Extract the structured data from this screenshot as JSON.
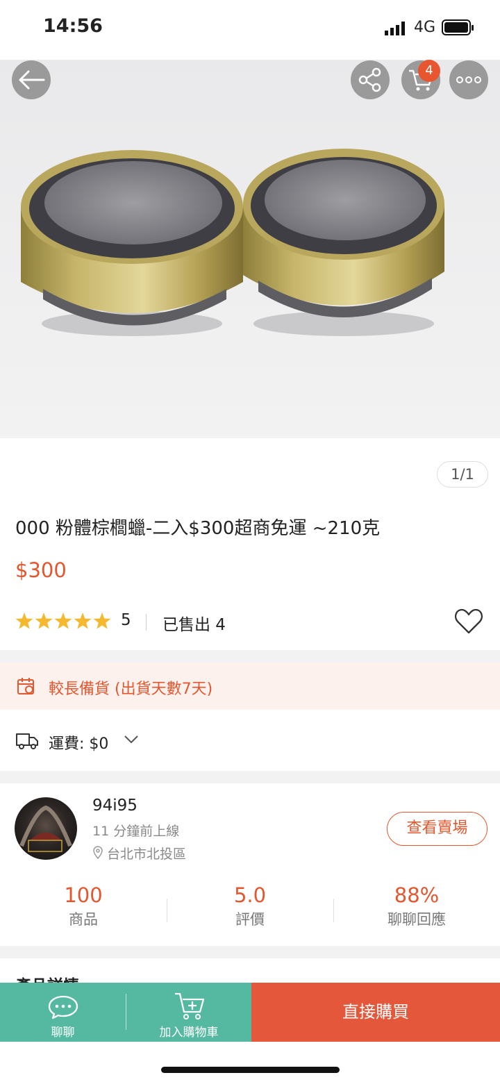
{
  "status_bar": {
    "time": "14:56",
    "network": "4G"
  },
  "product": {
    "image_counter": "1/1",
    "title": "000 粉體棕櫚蠟-二入$300超商免運 ~210克",
    "price": "$300",
    "rating_value": 5,
    "rating_count": "5",
    "sold": "已售出 4",
    "cart_count": "4"
  },
  "notices": {
    "preorder": "較長備貨 (出貨天數7天)",
    "shipping": "運費: $0"
  },
  "seller": {
    "name": "94i95",
    "online": "11 分鐘前上線",
    "location": "台北市北投區",
    "view_shop_label": "查看賣場",
    "stats": [
      {
        "value": "100",
        "label": "商品"
      },
      {
        "value": "5.0",
        "label": "評價"
      },
      {
        "value": "88%",
        "label": "聊聊回應"
      }
    ]
  },
  "details_peek": "產品詳情",
  "bottom_bar": {
    "chat_label": "聊聊",
    "add_cart_label": "加入購物車",
    "buy_now_label": "直接購買"
  },
  "colors": {
    "accent": "#e4572e",
    "green": "#55b9a2",
    "buy": "#e4573a",
    "star": "#f5b82e"
  },
  "icons": [
    "back-icon",
    "share-icon",
    "cart-icon",
    "more-icon",
    "heart-icon",
    "calendar-icon",
    "truck-icon",
    "chevron-down-icon",
    "location-icon",
    "chat-icon",
    "add-cart-icon"
  ]
}
